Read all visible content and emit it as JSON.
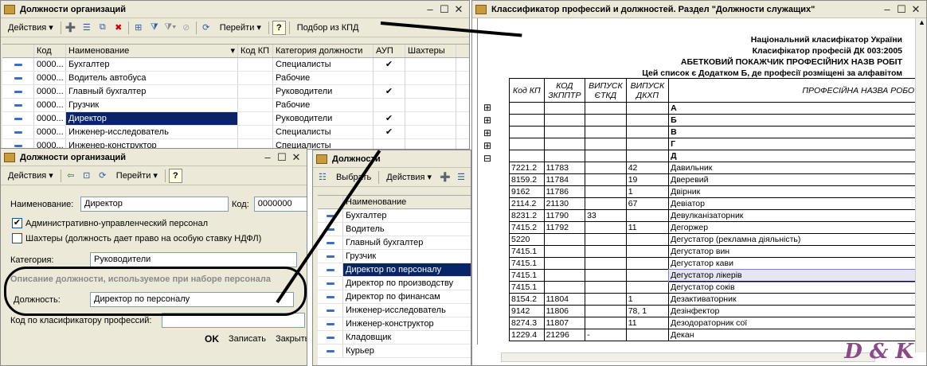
{
  "org_list_window": {
    "title": "Должности организаций",
    "toolbar": {
      "actions": "Действия",
      "goto": "Перейти",
      "help": "?",
      "kpd": "Подбор из КПД",
      "more": "»"
    },
    "columns": [
      "Код",
      "Наименование",
      "Код КП",
      "Категория должности",
      "АУП",
      "Шахтеры"
    ],
    "rows": [
      {
        "code": "0000...",
        "name": "Бухгалтер",
        "kp": "",
        "cat": "Специалисты",
        "aup": "✔"
      },
      {
        "code": "0000...",
        "name": "Водитель автобуса",
        "kp": "",
        "cat": "Рабочие",
        "aup": ""
      },
      {
        "code": "0000...",
        "name": "Главный бухгалтер",
        "kp": "",
        "cat": "Руководители",
        "aup": "✔"
      },
      {
        "code": "0000...",
        "name": "Грузчик",
        "kp": "",
        "cat": "Рабочие",
        "aup": ""
      },
      {
        "code": "0000...",
        "name": "Директор",
        "kp": "",
        "cat": "Руководители",
        "aup": "✔"
      },
      {
        "code": "0000...",
        "name": "Инженер-исследователь",
        "kp": "",
        "cat": "Специалисты",
        "aup": "✔"
      },
      {
        "code": "0000...",
        "name": "Инженер-конструктор",
        "kp": "",
        "cat": "Специалисты",
        "aup": ""
      }
    ]
  },
  "org_form_window": {
    "title": "Должности организаций",
    "toolbar": {
      "actions": "Действия",
      "goto": "Перейти",
      "help": "?"
    },
    "name_label": "Наименование:",
    "name_value": "Директор",
    "code_label": "Код:",
    "code_value": "0000000",
    "aup_label": "Административно-управленческий персонал",
    "aup_checked": "✔",
    "miners_label": "Шахтеры (должность дает право на особую ставку НДФЛ)",
    "category_label": "Категория:",
    "category_value": "Руководители",
    "group_label": "Описание должности, используемое при наборе персонала",
    "position_label": "Должность:",
    "position_value": "Директор по персоналу",
    "kp_label": "Код по класификатору профессий:",
    "kp_value": "",
    "buttons": {
      "ok": "OK",
      "save": "Записать",
      "close": "Закрыть"
    }
  },
  "positions_window": {
    "title": "Должности",
    "toolbar": {
      "select": "Выбрать",
      "actions": "Действия"
    },
    "column": "Наименование",
    "items": [
      "Бухгалтер",
      "Водитель",
      "Главный бухгалтер",
      "Грузчик",
      "Директор по персоналу",
      "Директор по производству",
      "Директор по финансам",
      "Инженер-исследователь",
      "Инженер-конструктор",
      "Кладовщик",
      "Курьер"
    ],
    "selected_index": 4
  },
  "classifier_window": {
    "title": "Классификатор профессий и должностей. Раздел \"Должности служащих\"",
    "header_lines": [
      "Національний класифікатор України",
      "Класифікатор професій ДК 003:2005",
      "АБЕТКОВИЙ ПОКАЖЧИК ПРОФЕСІЙНИХ НАЗВ РОБІТ",
      "Цей список є Додатком Б, де професії розміщені за алфавітом"
    ],
    "columns": [
      "Код КП",
      "КОД ЗКППТР",
      "ВИПУСК ЄТКД",
      "ВИПУСК ДКХП",
      "ПРОФЕСІЙНА НАЗВА РОБОТИ"
    ],
    "letter_rows": [
      "А",
      "Б",
      "В",
      "Г",
      "Д"
    ],
    "rows": [
      [
        "7221.2",
        "11783",
        "",
        "42",
        "Давильник"
      ],
      [
        "8159.2",
        "11784",
        "",
        "19",
        "Дверевий"
      ],
      [
        "9162",
        "11786",
        "",
        "1",
        "Двірник"
      ],
      [
        "2114.2",
        "21130",
        "",
        "67",
        "Девіатор"
      ],
      [
        "8231.2",
        "11790",
        "33",
        "",
        "Девулканізаторник"
      ],
      [
        "7415.2",
        "11792",
        "",
        "11",
        "Дегоржер"
      ],
      [
        "5220",
        "",
        "",
        "",
        "Дегустатор (рекламна діяльність)"
      ],
      [
        "7415.1",
        "",
        "",
        "",
        "Дегустатор вин"
      ],
      [
        "7415.1",
        "",
        "",
        "",
        "Дегустатор кави"
      ],
      [
        "7415.1",
        "",
        "",
        "",
        "Дегустатор лікерів"
      ],
      [
        "7415.1",
        "",
        "",
        "",
        "Дегустатор соків"
      ],
      [
        "8154.2",
        "11804",
        "",
        "1",
        "Дезактиваторник"
      ],
      [
        "9142",
        "11806",
        "",
        "78, 1",
        "Дезінфектор"
      ],
      [
        "8274.3",
        "11807",
        "",
        "11",
        "Дезодораторник сої"
      ],
      [
        "1229.4",
        "21296",
        "-",
        "",
        "Декан"
      ]
    ],
    "highlighted_row": 9
  },
  "watermark": "D & K"
}
